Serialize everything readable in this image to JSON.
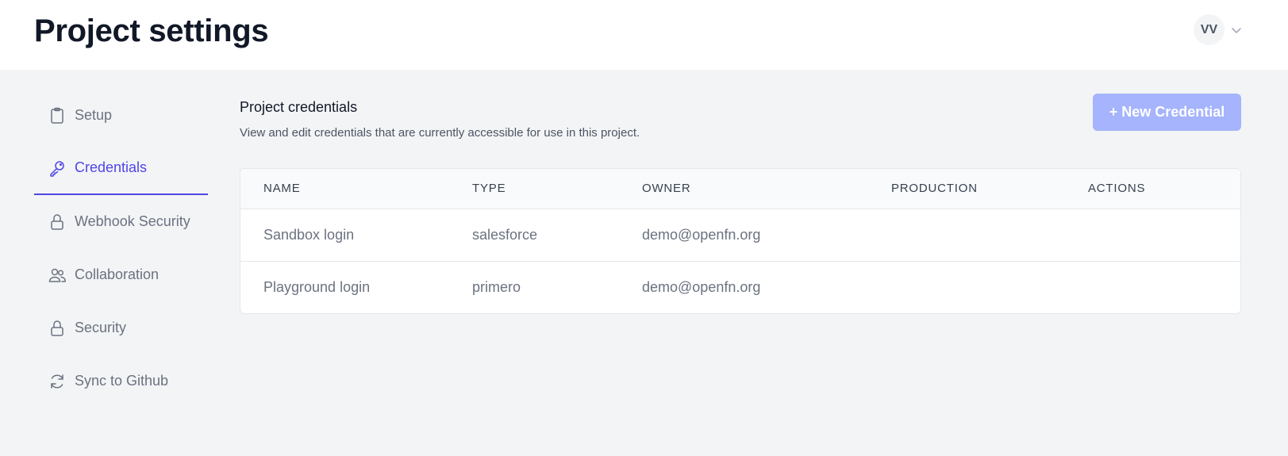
{
  "header": {
    "title": "Project settings",
    "user_initials": "VV"
  },
  "sidebar": {
    "items": [
      {
        "label": "Setup",
        "icon": "clipboard-icon",
        "active": false
      },
      {
        "label": "Credentials",
        "icon": "key-icon",
        "active": true
      },
      {
        "label": "Webhook Security",
        "icon": "lock-icon",
        "active": false
      },
      {
        "label": "Collaboration",
        "icon": "users-icon",
        "active": false
      },
      {
        "label": "Security",
        "icon": "lock-icon",
        "active": false
      },
      {
        "label": "Sync to Github",
        "icon": "sync-icon",
        "active": false
      }
    ]
  },
  "main": {
    "section_title": "Project credentials",
    "section_description": "View and edit credentials that are currently accessible for use in this project.",
    "new_button_label": "+ New Credential",
    "table": {
      "columns": [
        "NAME",
        "TYPE",
        "OWNER",
        "PRODUCTION",
        "ACTIONS"
      ],
      "rows": [
        {
          "name": "Sandbox login",
          "type": "salesforce",
          "owner": "demo@openfn.org",
          "production": "",
          "actions": ""
        },
        {
          "name": "Playground login",
          "type": "primero",
          "owner": "demo@openfn.org",
          "production": "",
          "actions": ""
        }
      ]
    }
  },
  "colors": {
    "accent": "#4f46e5",
    "button_bg": "#a5b4fc",
    "page_bg": "#f3f4f6"
  }
}
